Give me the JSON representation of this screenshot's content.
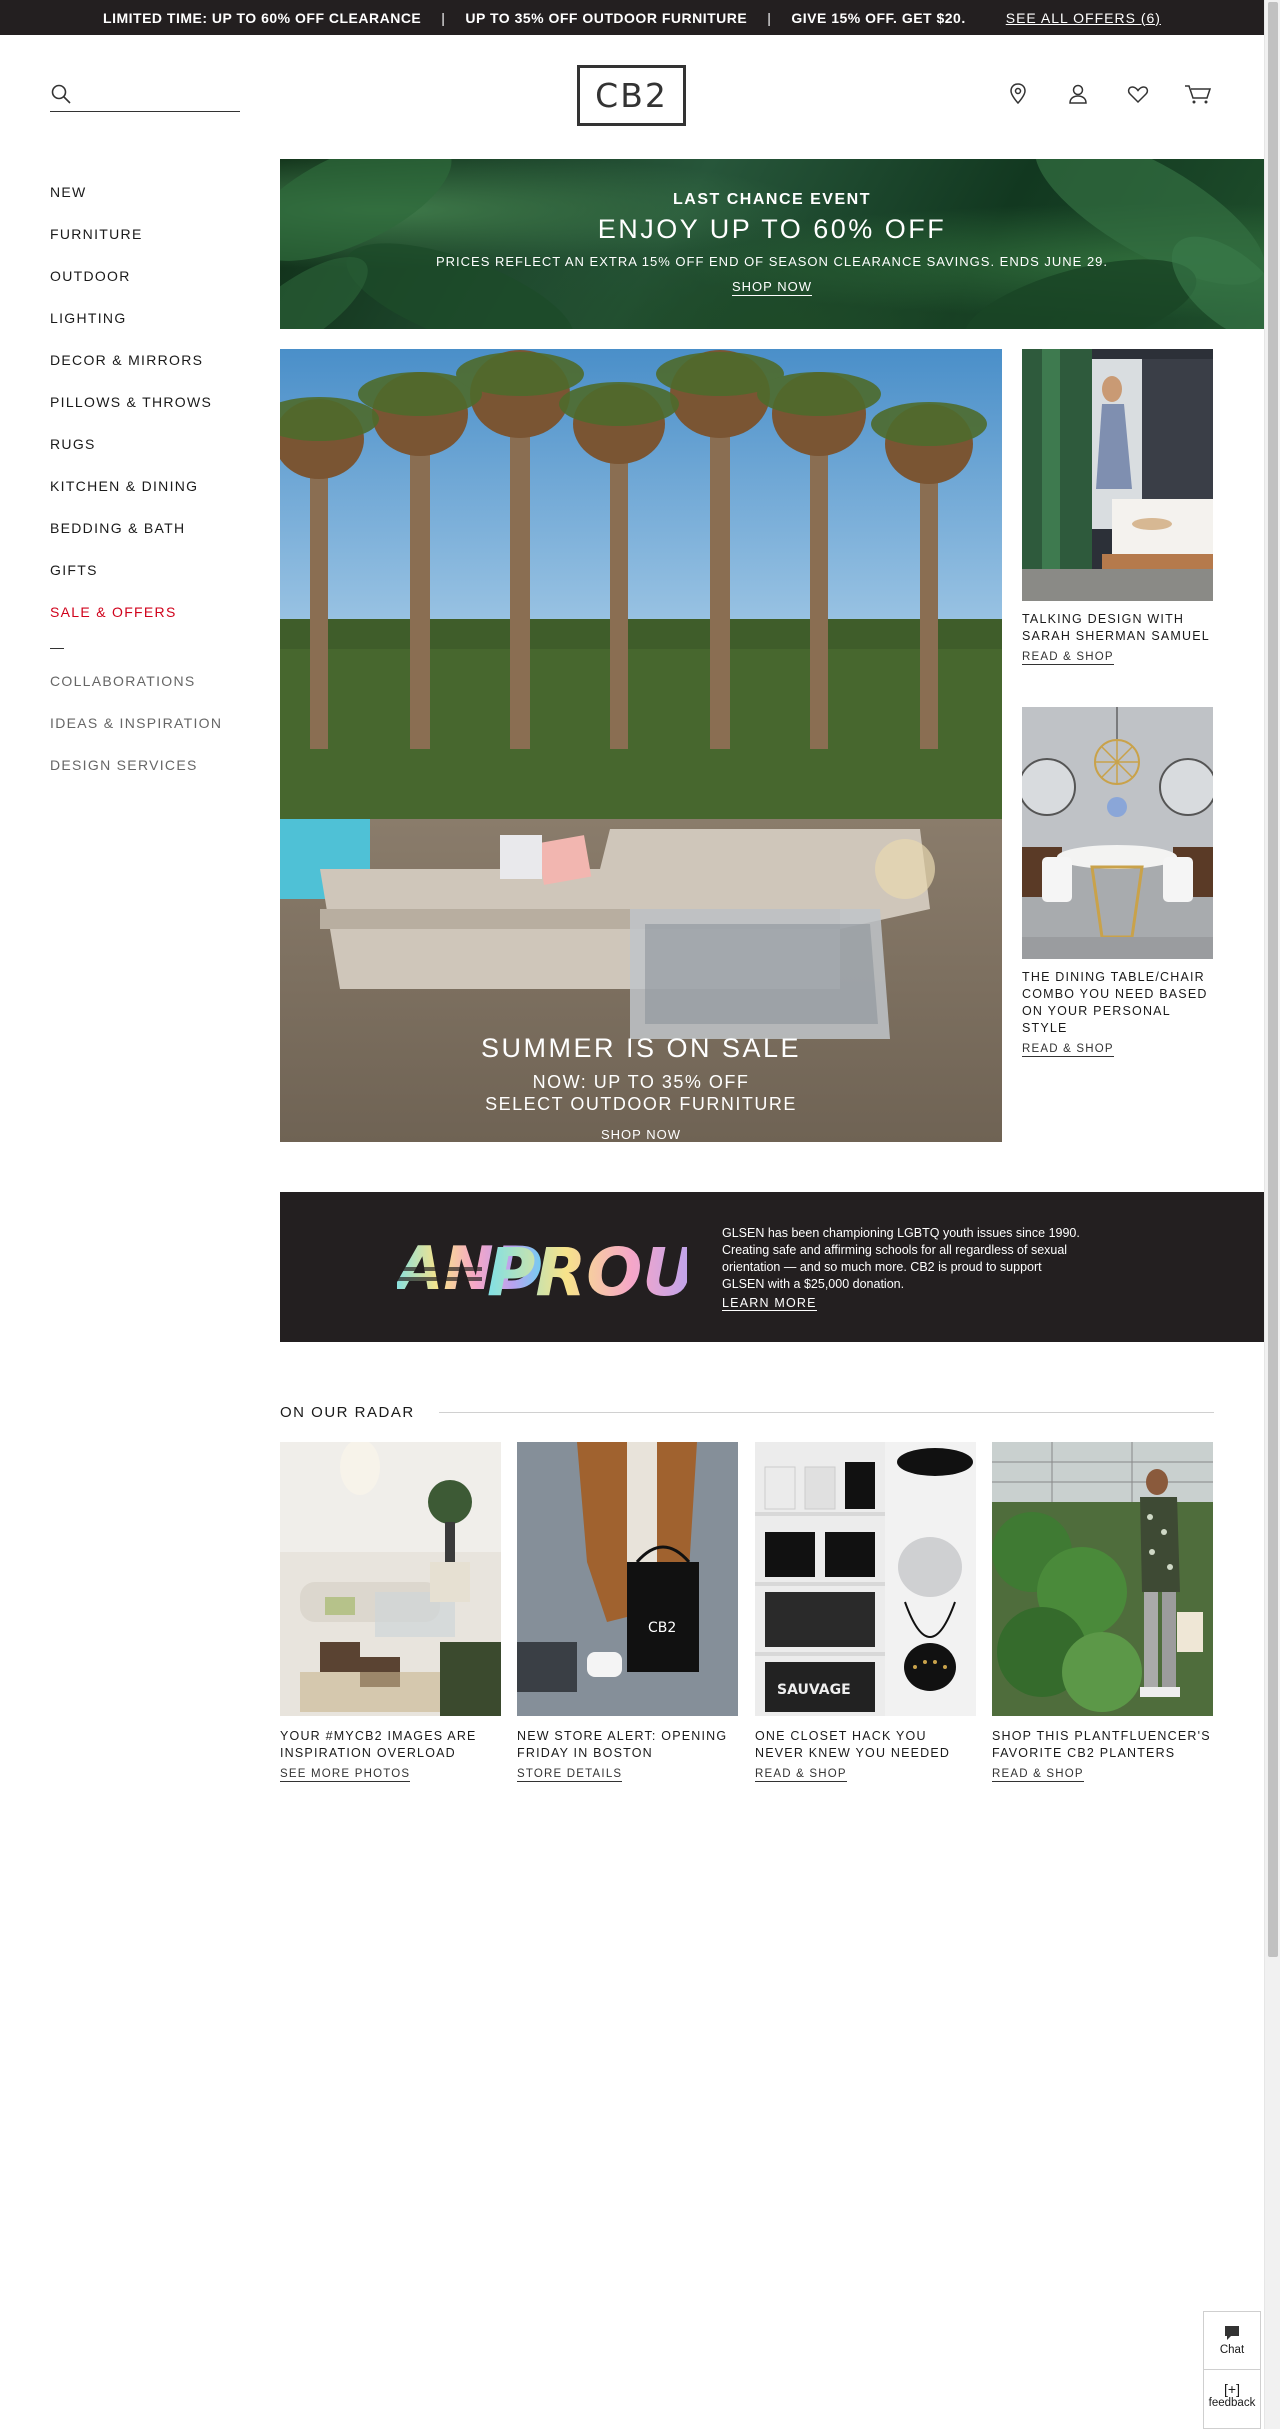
{
  "promo": {
    "item1": "LIMITED TIME: UP TO 60% OFF CLEARANCE",
    "sep1": "|",
    "item2": "UP TO 35% OFF OUTDOOR FURNITURE",
    "sep2": "|",
    "item3": "GIVE 15% OFF. GET $20.",
    "offers_link": "SEE ALL OFFERS (6)"
  },
  "header": {
    "logo": "CB2",
    "search_placeholder": "",
    "icons": [
      "location-pin-icon",
      "account-icon",
      "heart-icon",
      "cart-icon"
    ]
  },
  "nav": {
    "items": [
      "NEW",
      "FURNITURE",
      "OUTDOOR",
      "LIGHTING",
      "DECOR & MIRRORS",
      "PILLOWS & THROWS",
      "RUGS",
      "KITCHEN & DINING",
      "BEDDING & BATH",
      "GIFTS"
    ],
    "sale": "SALE & OFFERS",
    "secondary": [
      "COLLABORATIONS",
      "IDEAS & INSPIRATION",
      "DESIGN SERVICES"
    ]
  },
  "banner": {
    "eyebrow": "LAST CHANCE EVENT",
    "headline": "ENJOY UP TO 60% OFF",
    "fine": "PRICES REFLECT AN EXTRA 15% OFF END OF SEASON CLEARANCE SAVINGS. ENDS JUNE 29.",
    "cta": "SHOP NOW"
  },
  "hero": {
    "headline": "SUMMER IS ON SALE",
    "line1": "NOW: UP TO 35% OFF",
    "line2": "SELECT OUTDOOR FURNITURE",
    "cta": "SHOP NOW"
  },
  "articles": [
    {
      "title": "TALKING DESIGN WITH SARAH SHERMAN SAMUEL",
      "link": "READ & SHOP"
    },
    {
      "title": "THE DINING TABLE/CHAIR COMBO YOU NEED BASED ON YOUR PERSONAL STYLE",
      "link": "READ & SHOP"
    }
  ],
  "pride": {
    "logo_text_1": "AND",
    "logo_text_2": "PROUD",
    "text": "GLSEN has been championing LGBTQ youth issues since 1990. Creating safe and affirming schools for all regardless of sexual orientation — and so much more. CB2 is proud to support GLSEN with a $25,000 donation.",
    "cta": "LEARN MORE"
  },
  "radar": {
    "heading": "ON OUR RADAR",
    "cards": [
      {
        "title": "YOUR #MYCB2 IMAGES ARE INSPIRATION OVERLOAD",
        "link": "SEE MORE PHOTOS"
      },
      {
        "title": "NEW STORE ALERT: OPENING FRIDAY IN BOSTON",
        "link": "STORE DETAILS",
        "bag_label": "CB2"
      },
      {
        "title": "ONE CLOSET HACK YOU NEVER KNEW YOU NEEDED",
        "link": "READ & SHOP",
        "box_label": "SAUVAGE"
      },
      {
        "title": "SHOP THIS PLANTFLUENCER'S FAVORITE CB2 PLANTERS",
        "link": "READ & SHOP"
      }
    ]
  },
  "widget": {
    "chat": "Chat",
    "feedback_icon": "[+]",
    "feedback": "feedback"
  },
  "colors": {
    "promo_bg": "#231f20",
    "sale": "#d0021b",
    "text": "#1a1a1a"
  }
}
